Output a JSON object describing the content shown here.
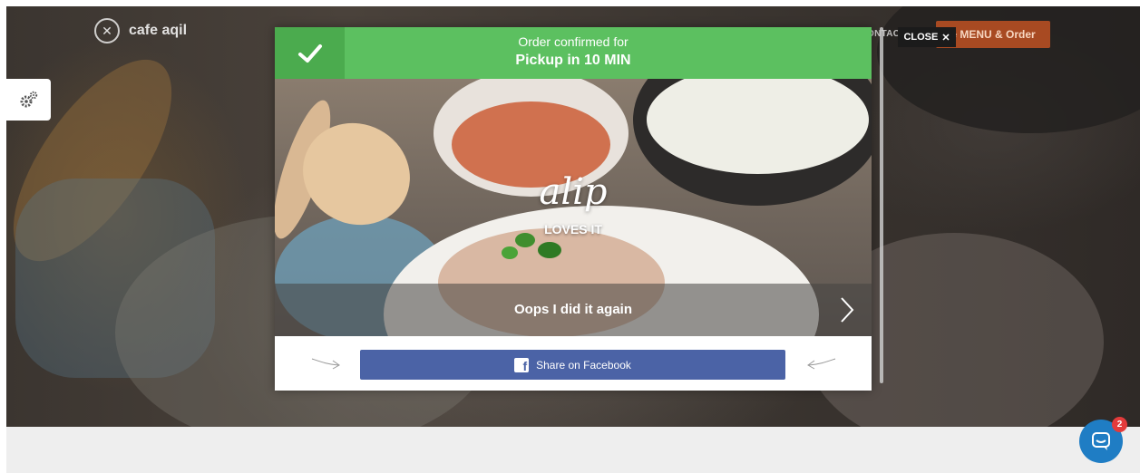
{
  "header": {
    "brand_name": "cafe aqil",
    "nav_contact": "ONTACT",
    "menu_button": "e MENU & Order",
    "close_button": "CLOSE",
    "close_icon": "close-x-icon"
  },
  "settings": {
    "icon": "gears-icon"
  },
  "modal": {
    "confirmed_line1": "Order confirmed for",
    "confirmed_line2": "Pickup in 10 MIN",
    "check_icon": "checkmark-icon",
    "signature": "alip",
    "loves": "LOVES IT",
    "caption": "Oops I did it again",
    "next_icon": "chevron-right-icon",
    "share_label": "Share on Facebook",
    "share_icon": "facebook-icon"
  },
  "chat": {
    "badge": "2",
    "icon": "chat-bubble-icon"
  },
  "colors": {
    "header_green": "#5cc060",
    "check_green": "#4bab4e",
    "facebook_blue": "#4b63a6",
    "menu_orange": "#a84a22",
    "chat_blue": "#1f7dc4",
    "badge_red": "#e33b3b"
  }
}
